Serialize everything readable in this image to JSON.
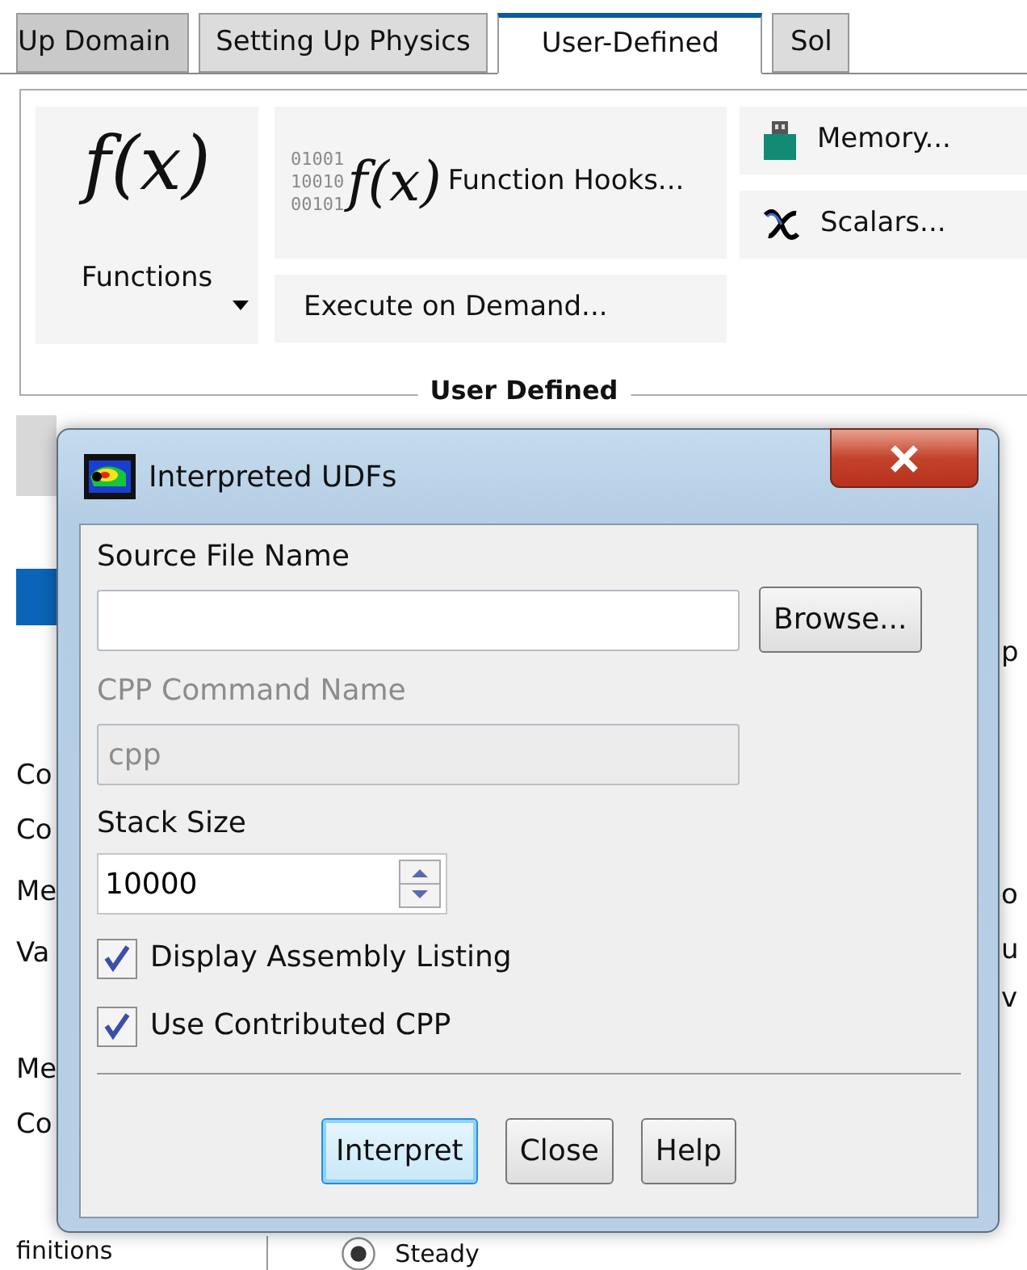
{
  "ribbon_tabs": [
    {
      "label": "Up Domain",
      "selected": false
    },
    {
      "label": "Setting Up Physics",
      "selected": false
    },
    {
      "label": "User-Defined",
      "selected": true
    },
    {
      "label": "Sol",
      "selected": false
    }
  ],
  "ribbon": {
    "functions": {
      "glyph": "f(x)",
      "label": "Functions"
    },
    "function_hooks": {
      "glyph": "f(x)",
      "bits": [
        "01001",
        "10010",
        "00101"
      ],
      "label": "Function Hooks..."
    },
    "execute_on_demand": {
      "label": "Execute on Demand..."
    },
    "memory": {
      "label": "Memory..."
    },
    "scalars": {
      "label": "Scalars..."
    },
    "group_label": "User Defined"
  },
  "background": {
    "left_fragments": [
      "Co",
      "Co",
      "Me",
      "Va",
      "Me",
      "Co"
    ],
    "bottom_left": "finitions",
    "radio": {
      "label": "Steady",
      "selected": true
    },
    "right_fragments": [
      "p",
      "o",
      "u",
      "v"
    ]
  },
  "dialog": {
    "title": "Interpreted UDFs",
    "source_file": {
      "label": "Source File Name",
      "disabled": false
    },
    "browse_button": "Browse...",
    "cpp_command": {
      "label": "CPP Command Name",
      "value": "cpp",
      "disabled": true
    },
    "stack_size": {
      "label": "Stack Size",
      "value": "10000"
    },
    "options": [
      {
        "label": "Display Assembly Listing",
        "checked": true
      },
      {
        "label": "Use Contributed CPP",
        "checked": true
      }
    ],
    "buttons": [
      {
        "label": "Interpret",
        "focused": true
      },
      {
        "label": "Close",
        "focused": false
      },
      {
        "label": "Help",
        "focused": false
      }
    ]
  }
}
